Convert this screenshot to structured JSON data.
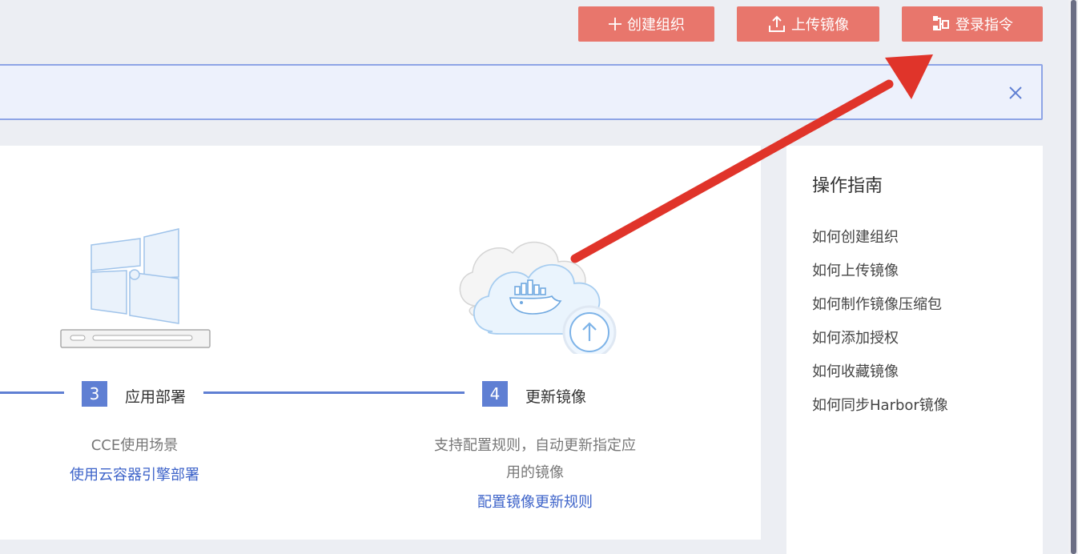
{
  "toolbar": {
    "create_org_label": "创建组织",
    "upload_image_label": "上传镜像",
    "login_command_label": "登录指令"
  },
  "steps": [
    {
      "number": "3",
      "title": "应用部署",
      "description": "CCE使用场景",
      "link": "使用云容器引擎部署"
    },
    {
      "number": "4",
      "title": "更新镜像",
      "description_line1": "支持配置规则，自动更新指定应",
      "description_line2": "用的镜像",
      "link": "配置镜像更新规则"
    }
  ],
  "guide": {
    "title": "操作指南",
    "items": [
      "如何创建组织",
      "如何上传镜像",
      "如何制作镜像压缩包",
      "如何添加授权",
      "如何收藏镜像",
      "如何同步Harbor镜像"
    ]
  },
  "colors": {
    "button_bg": "#e8766c",
    "accent_blue": "#5f7fd3",
    "link_blue": "#3d63c9",
    "annotation_red": "#e0342a"
  },
  "icons": {
    "create_org": "plus-icon",
    "upload_image": "upload-icon",
    "login_command": "login-command-icon",
    "close": "close-icon"
  }
}
